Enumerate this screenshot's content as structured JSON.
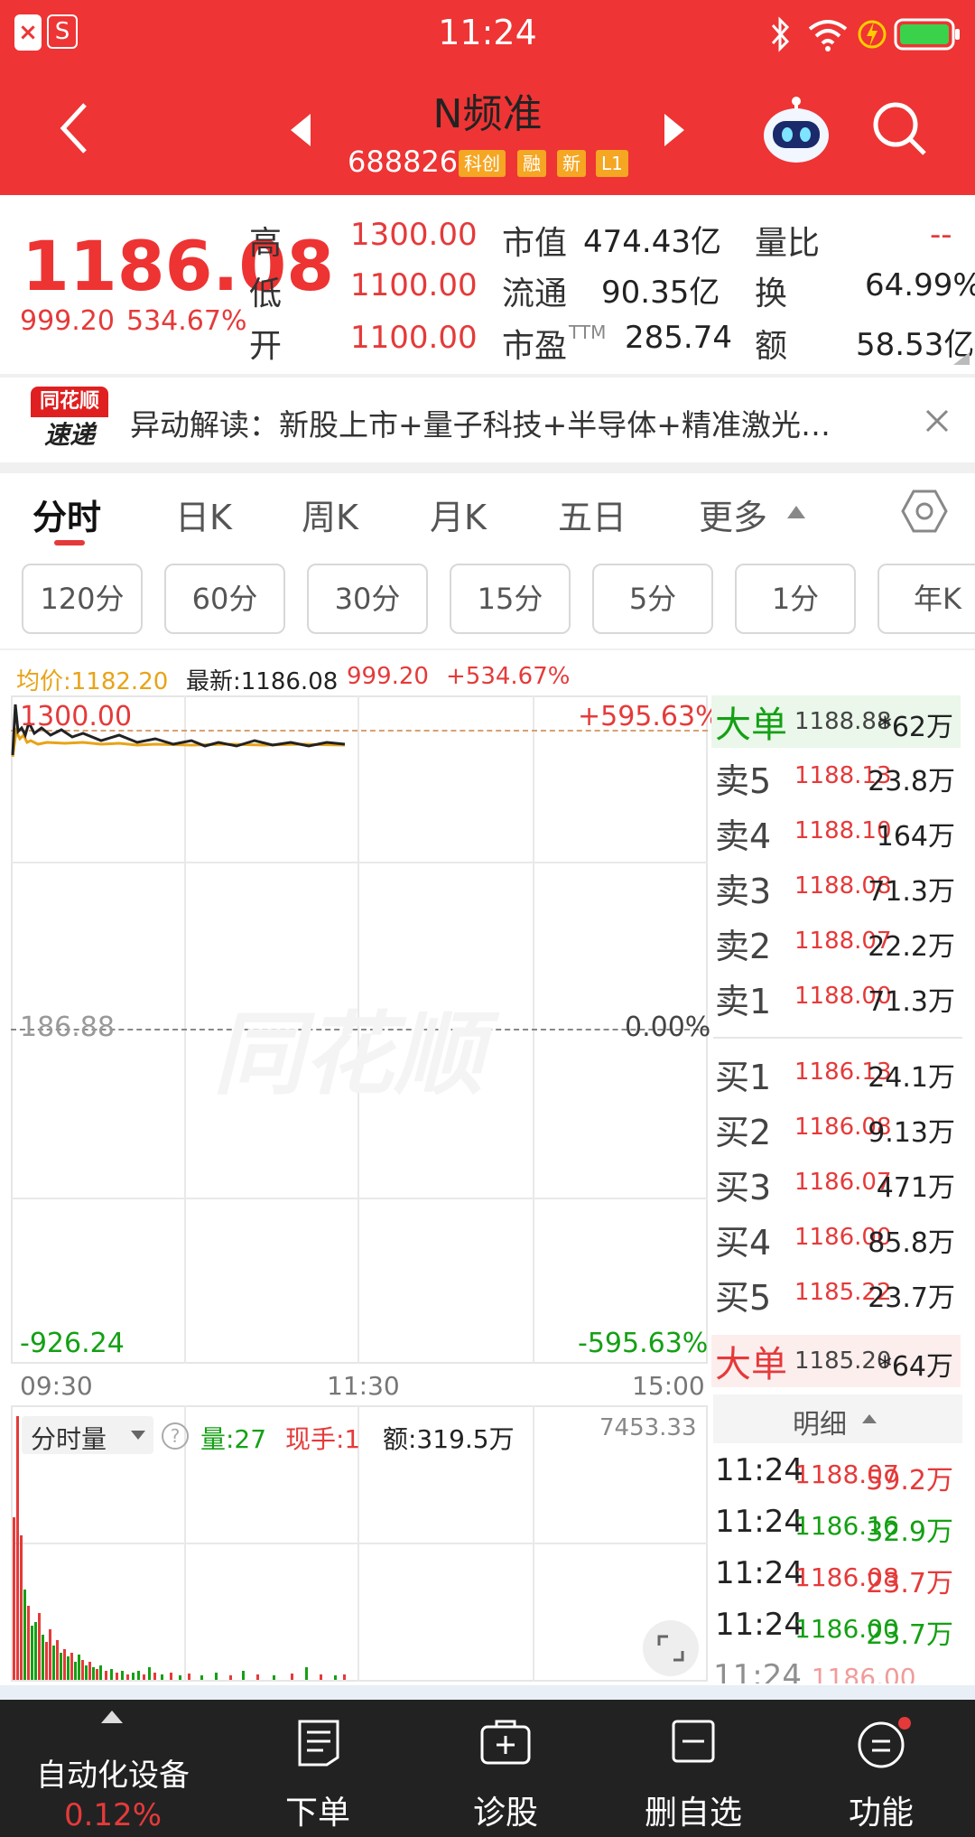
{
  "status_bar": {
    "time": "11:24",
    "left_icons": [
      "x-badge-icon",
      "s-badge-icon"
    ],
    "right_icons": [
      "bluetooth-icon",
      "wifi-icon",
      "charging-icon",
      "battery-icon"
    ]
  },
  "header": {
    "title": "N频准",
    "code": "688826",
    "tags": [
      "科创",
      "融",
      "新",
      "L1"
    ]
  },
  "quote": {
    "price": "1186.08",
    "change": "999.20",
    "change_pct": "534.67%",
    "high_label": "高",
    "high": "1300.00",
    "low_label": "低",
    "low": "1100.00",
    "open_label": "开",
    "open": "1100.00",
    "mcap_label": "市值",
    "mcap": "474.43亿",
    "float_label": "流通",
    "float": "90.35亿",
    "pe_label": "市盈",
    "pe_sup": "TTM",
    "pe": "285.74",
    "vr_label": "量比",
    "vr": "--",
    "turnover_label": "换",
    "turnover": "64.99%",
    "amount_label": "额",
    "amount": "58.53亿"
  },
  "alert": {
    "logo_top": "同花顺",
    "logo_bottom": "速递",
    "text": "异动解读：新股上市+量子科技+半导体+精准激光…"
  },
  "tabs": [
    "分时",
    "日K",
    "周K",
    "月K",
    "五日",
    "更多"
  ],
  "intervals": [
    "120分",
    "60分",
    "30分",
    "15分",
    "5分",
    "1分",
    "年K"
  ],
  "chart_header": {
    "avg_label": "均价:1182.20",
    "last_label": "最新:1186.08",
    "change": "999.20",
    "change_pct": "+534.67%"
  },
  "chart": {
    "top_price": "1300.00",
    "top_pct": "+595.63%",
    "mid_price": "186.88",
    "mid_pct": "0.00%",
    "bot_price": "-926.24",
    "bot_pct": "-595.63%",
    "time_start": "09:30",
    "time_mid": "11:30",
    "time_end": "15:00",
    "watermark": "同花顺"
  },
  "volume": {
    "mode": "分时量",
    "vol": "量:27",
    "hand": "现手:1",
    "amount": "额:319.5万",
    "max": "7453.33"
  },
  "orderbook": {
    "big_sell": {
      "label": "大单",
      "price": "1188.88",
      "vol": "*62万"
    },
    "sells": [
      {
        "label": "卖5",
        "price": "1188.13",
        "vol": "23.8万"
      },
      {
        "label": "卖4",
        "price": "1188.10",
        "vol": "164万"
      },
      {
        "label": "卖3",
        "price": "1188.08",
        "vol": "71.3万"
      },
      {
        "label": "卖2",
        "price": "1188.07",
        "vol": "22.2万"
      },
      {
        "label": "卖1",
        "price": "1188.00",
        "vol": "71.3万"
      }
    ],
    "buys": [
      {
        "label": "买1",
        "price": "1186.13",
        "vol": "24.1万"
      },
      {
        "label": "买2",
        "price": "1186.08",
        "vol": "9.13万"
      },
      {
        "label": "买3",
        "price": "1186.07",
        "vol": "471万"
      },
      {
        "label": "买4",
        "price": "1186.00",
        "vol": "85.8万"
      },
      {
        "label": "买5",
        "price": "1185.22",
        "vol": "23.7万"
      }
    ],
    "big_buy": {
      "label": "大单",
      "price": "1185.20",
      "vol": "*64万"
    },
    "detail_label": "明细"
  },
  "ticks": [
    {
      "time": "11:24",
      "price": "1188.07",
      "vol": "59.2万",
      "dir": "up"
    },
    {
      "time": "11:24",
      "price": "1186.16",
      "vol": "32.9万",
      "dir": "down"
    },
    {
      "time": "11:24",
      "price": "1186.08",
      "vol": "23.7万",
      "dir": "up"
    },
    {
      "time": "11:24",
      "price": "1186.00",
      "vol": "23.7万",
      "dir": "down"
    }
  ],
  "bottom_nav": {
    "sector_name": "自动化设备",
    "sector_pct": "0.12%",
    "items": [
      "下单",
      "诊股",
      "删自选",
      "功能"
    ]
  },
  "colors": {
    "brand_red": "#ee3434",
    "up_red": "#e53a3a",
    "down_green": "#14a014",
    "avg_orange": "#e8a317"
  }
}
